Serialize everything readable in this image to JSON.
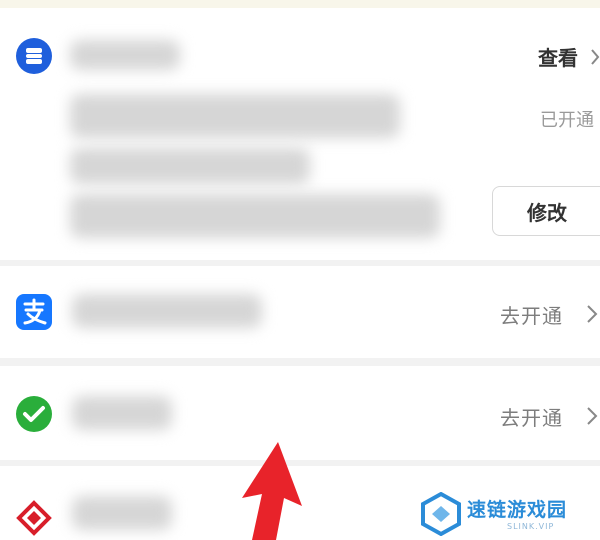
{
  "card1": {
    "view_label": "查看",
    "status_text": "已开通",
    "edit_label": "修改"
  },
  "card2": {
    "action_label": "去开通"
  },
  "card3": {
    "action_label": "去开通"
  },
  "watermark": {
    "title": "速链游戏园",
    "subtitle": "SLINK.VIP"
  },
  "colors": {
    "bank_blue": "#1f5fdc",
    "alipay_blue": "#1677ff",
    "wechat_green": "#2aae3b",
    "unionpay_red": "#d81e2a",
    "arrow_red": "#e8232a",
    "watermark_blue": "#2b8cd8"
  },
  "icons": [
    "bank-card-icon",
    "alipay-icon",
    "wechat-pay-icon",
    "unionpay-icon",
    "chevron-right-icon",
    "red-arrow-pointer",
    "watermark-logo-icon"
  ]
}
